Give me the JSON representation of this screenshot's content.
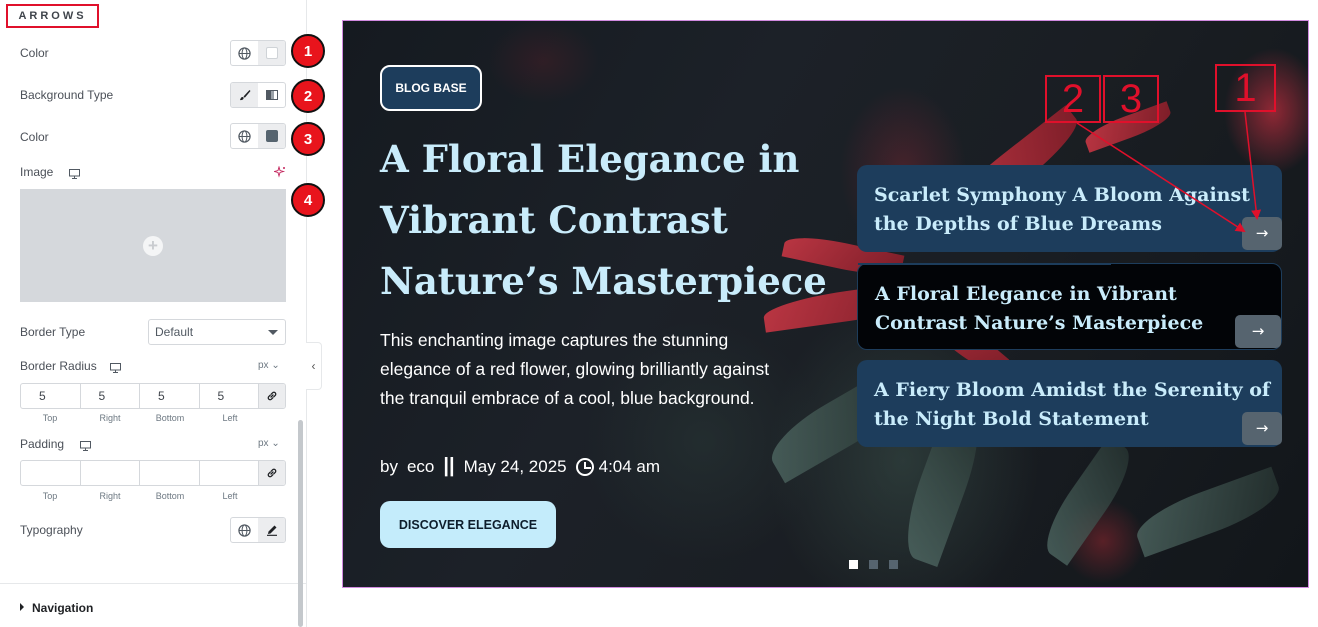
{
  "panel": {
    "section_title": "ARROWS",
    "color_label": "Color",
    "bg_type_label": "Background Type",
    "color2_label": "Color",
    "image_label": "Image",
    "border_type_label": "Border Type",
    "border_type_value": "Default",
    "border_radius_label": "Border Radius",
    "border_radius_unit": "px",
    "border_radius_values": [
      "5",
      "5",
      "5",
      "5"
    ],
    "side_labels": [
      "Top",
      "Right",
      "Bottom",
      "Left"
    ],
    "padding_label": "Padding",
    "padding_unit": "px",
    "padding_values": [
      "",
      "",
      "",
      ""
    ],
    "typography_label": "Typography",
    "navigation_label": "Navigation",
    "badges": [
      "1",
      "2",
      "3",
      "4"
    ]
  },
  "preview": {
    "badge": "BLOG BASE",
    "hero_title": "A Floral Elegance in Vibrant Contrast Nature’s Masterpiece",
    "hero_desc": "This enchanting image captures the stunning elegance of a red flower, glowing brilliantly against the tranquil embrace of a cool, blue background.",
    "meta": {
      "by": "by",
      "author": "eco",
      "separator": "||",
      "date": "May 24, 2025",
      "time": "4:04 am"
    },
    "cta": "DISCOVER ELEGANCE",
    "cards": [
      {
        "title": "Scarlet Symphony A Bloom Against the Depths of Blue Dreams",
        "arrow": "→"
      },
      {
        "title": "A Floral Elegance in Vibrant Contrast Nature’s Masterpiece",
        "arrow": "→"
      },
      {
        "title": "A Fiery Bloom Amidst the Serenity of the Night Bold Statement",
        "arrow": "→"
      }
    ],
    "active_slide": 0,
    "slide_count": 3
  },
  "annotations": {
    "label_1": "1",
    "label_2": "2",
    "label_3": "3"
  },
  "colors": {
    "accent_red": "#e0102b",
    "card_blue": "#1d3d5c",
    "title_blue": "#c9ecfb",
    "arrow_grey": "#56646f"
  }
}
